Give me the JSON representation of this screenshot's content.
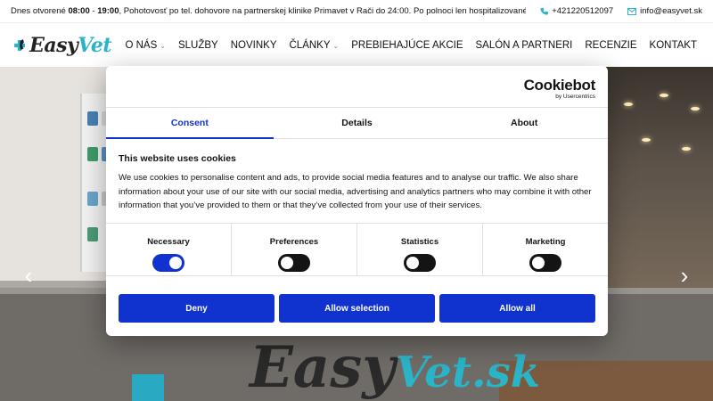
{
  "topbar": {
    "hours_prefix": "Dnes otvorené ",
    "hours_open": "08:00",
    "hours_sep": " - ",
    "hours_close": "19:00",
    "hours_note": ", Pohotovosť po tel. dohovore na partnerskej klinike Primavet v Rači do 24:00. Po polnoci len hospitalizované zvieratá.",
    "phone": "+421220512097",
    "email": "info@easyvet.sk"
  },
  "logo": {
    "part1": "Easy",
    "part2": "Vet"
  },
  "nav": {
    "items": [
      {
        "label": "O NÁS",
        "dropdown": true
      },
      {
        "label": "SLUŽBY",
        "dropdown": false
      },
      {
        "label": "NOVINKY",
        "dropdown": false
      },
      {
        "label": "ČLÁNKY",
        "dropdown": true
      },
      {
        "label": "PREBIEHAJÚCE AKCIE",
        "dropdown": false
      },
      {
        "label": "SALÓN A PARTNERI",
        "dropdown": false
      },
      {
        "label": "RECENZIE",
        "dropdown": false
      },
      {
        "label": "KONTAKT",
        "dropdown": false
      }
    ]
  },
  "hero": {
    "sign_part1": "Easy",
    "sign_part2": "Vet.sk"
  },
  "cookie": {
    "brand": "Cookiebot",
    "brand_by": "by Usercentrics",
    "tabs": [
      "Consent",
      "Details",
      "About"
    ],
    "active_tab": "Consent",
    "heading": "This website uses cookies",
    "text": "We use cookies to personalise content and ads, to provide social media features and to analyse our traffic. We also share information about your use of our site with our social media, advertising and analytics partners who may combine it with other information that you’ve provided to them or that they’ve collected from your use of their services.",
    "prefs": [
      {
        "label": "Necessary",
        "on": true
      },
      {
        "label": "Preferences",
        "on": false
      },
      {
        "label": "Statistics",
        "on": false
      },
      {
        "label": "Marketing",
        "on": false
      }
    ],
    "buttons": {
      "deny": "Deny",
      "allow_selection": "Allow selection",
      "allow_all": "Allow all"
    }
  },
  "colors": {
    "accent": "#1032cf",
    "brand": "#2bb3c7"
  }
}
